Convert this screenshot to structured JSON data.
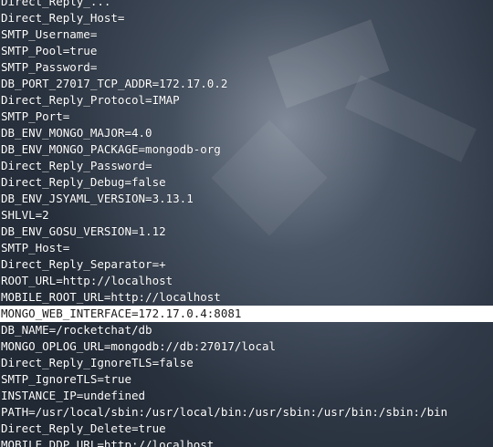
{
  "terminal": {
    "lines": [
      "Direct_Reply_...",
      "Direct_Reply_Host=",
      "SMTP_Username=",
      "SMTP_Pool=true",
      "SMTP_Password=",
      "DB_PORT_27017_TCP_ADDR=172.17.0.2",
      "Direct_Reply_Protocol=IMAP",
      "SMTP_Port=",
      "DB_ENV_MONGO_MAJOR=4.0",
      "DB_ENV_MONGO_PACKAGE=mongodb-org",
      "Direct_Reply_Password=",
      "Direct_Reply_Debug=false",
      "DB_ENV_JSYAML_VERSION=3.13.1",
      "SHLVL=2",
      "DB_ENV_GOSU_VERSION=1.12",
      "SMTP_Host=",
      "Direct_Reply_Separator=+",
      "ROOT_URL=http://localhost",
      "MOBILE_ROOT_URL=http://localhost",
      "MONGO_WEB_INTERFACE=172.17.0.4:8081",
      "DB_NAME=/rocketchat/db",
      "MONGO_OPLOG_URL=mongodb://db:27017/local",
      "Direct_Reply_IgnoreTLS=false",
      "SMTP_IgnoreTLS=true",
      "INSTANCE_IP=undefined",
      "PATH=/usr/local/sbin:/usr/local/bin:/usr/sbin:/usr/bin:/sbin:/bin",
      "Direct_Reply_Delete=true",
      "MOBILE_DDP_URL=http://localhost"
    ]
  }
}
